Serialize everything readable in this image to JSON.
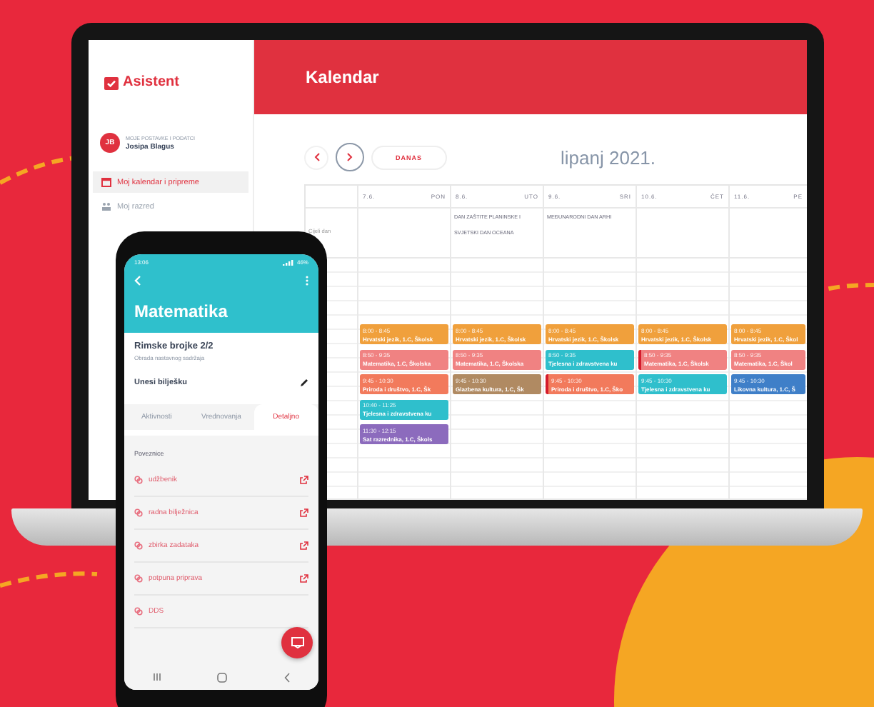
{
  "laptop": {
    "sidebar": {
      "logo": "Asistent",
      "avatar": "JB",
      "profile_label": "MOJE POSTAVKE I PODATCI",
      "user": "Josipa Blagus",
      "items": [
        {
          "label": "Moj kalendar i pripreme",
          "selected": true
        },
        {
          "label": "Moj razred",
          "selected": false
        }
      ]
    },
    "header": {
      "title": "Kalendar"
    },
    "toolbar": {
      "today_button": "DANAS",
      "month": "lipanj 2021."
    },
    "calendar": {
      "all_day_label": "Cijeli dan",
      "days": [
        {
          "date": "7.6.",
          "weekday": "PON",
          "events": [
            {
              "time": "8:00 - 8:45",
              "title": "Hrvatski jezik, 1.C, Školsk",
              "color": "#f0a03c",
              "flagged": false
            },
            {
              "time": "8:50 - 9:35",
              "title": "Matematika, 1.C, Školska",
              "color": "#f08282",
              "flagged": false
            },
            {
              "time": "9:45 - 10:30",
              "title": "Priroda i društvo, 1.C, Šk",
              "color": "#f27a5c",
              "flagged": false
            },
            {
              "time": "10:40 - 11:25",
              "title": "Tjelesna i zdravstvena ku",
              "color": "#2fbfcc",
              "flagged": false
            },
            {
              "time": "11:30 - 12:15",
              "title": "Sat razrednika, 1.C, Škols",
              "color": "#8c6bbd",
              "flagged": false
            }
          ]
        },
        {
          "date": "8.6.",
          "weekday": "UTO",
          "all_day": [
            "DAN ZAŠTITE PLANINSKE I",
            "SVJETSKI DAN OCEANA"
          ],
          "events": [
            {
              "time": "8:00 - 8:45",
              "title": "Hrvatski jezik, 1.C, Školsk",
              "color": "#f0a03c",
              "flagged": false
            },
            {
              "time": "8:50 - 9:35",
              "title": "Matematika, 1.C, Školska",
              "color": "#f08282",
              "flagged": false
            },
            {
              "time": "9:45 - 10:30",
              "title": "Glazbena kultura, 1.C, Šk",
              "color": "#b08a62",
              "flagged": false
            }
          ]
        },
        {
          "date": "9.6.",
          "weekday": "SRI",
          "all_day": [
            "MEĐUNARODNI DAN ARHI"
          ],
          "events": [
            {
              "time": "8:00 - 8:45",
              "title": "Hrvatski jezik, 1.C, Školsk",
              "color": "#f0a03c",
              "flagged": false
            },
            {
              "time": "8:50 - 9:35",
              "title": "Tjelesna i zdravstvena ku",
              "color": "#2fbfcc",
              "flagged": false
            },
            {
              "time": "9:45 - 10:30",
              "title": "Priroda i društvo, 1.C, Ško",
              "color": "#f27a5c",
              "flagged": true
            }
          ]
        },
        {
          "date": "10.6.",
          "weekday": "ČET",
          "events": [
            {
              "time": "8:00 - 8:45",
              "title": "Hrvatski jezik, 1.C, Školsk",
              "color": "#f0a03c",
              "flagged": false
            },
            {
              "time": "8:50 - 9:35",
              "title": "Matematika, 1.C, Školsk",
              "color": "#f08282",
              "flagged": true
            },
            {
              "time": "9:45 - 10:30",
              "title": "Tjelesna i zdravstvena ku",
              "color": "#2fbfcc",
              "flagged": false
            }
          ]
        },
        {
          "date": "11.6.",
          "weekday": "PE",
          "events": [
            {
              "time": "8:00 - 8:45",
              "title": "Hrvatski jezik, 1.C, Škol",
              "color": "#f0a03c",
              "flagged": false
            },
            {
              "time": "8:50 - 9:35",
              "title": "Matematika, 1.C, Škol",
              "color": "#f08282",
              "flagged": false
            },
            {
              "time": "9:45 - 10:30",
              "title": "Likovna kultura, 1.C, Š",
              "color": "#3f7fc8",
              "flagged": false
            }
          ]
        }
      ]
    }
  },
  "phone": {
    "status_time": "13:06",
    "battery": "46%",
    "title": "Matematika",
    "lesson": "Rimske brojke 2/2",
    "lesson_type": "Obrada nastavnog sadržaja",
    "note_prompt": "Unesi bilješku",
    "tabs": [
      {
        "label": "Aktivnosti",
        "selected": false
      },
      {
        "label": "Vrednovanja",
        "selected": false
      },
      {
        "label": "Detaljno",
        "selected": true
      }
    ],
    "section": "Poveznice",
    "links": [
      {
        "label": "udžbenik",
        "external": true
      },
      {
        "label": "radna bilježnica",
        "external": true
      },
      {
        "label": "zbirka zadataka",
        "external": true
      },
      {
        "label": "potpuna priprava",
        "external": true
      },
      {
        "label": "DDS",
        "external": false
      }
    ]
  }
}
